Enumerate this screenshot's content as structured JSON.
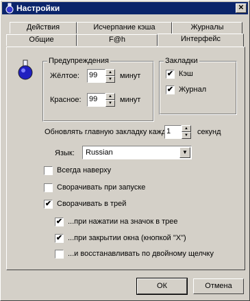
{
  "window": {
    "title": "Настройки",
    "close_glyph": "✕"
  },
  "tabs_row1": [
    "Действия",
    "Исчерпание кэша",
    "Журналы"
  ],
  "tabs_row2": [
    "Общие",
    "F@h",
    "Интерфейс"
  ],
  "active_tab": "Интерфейс",
  "warnings": {
    "title": "Предупреждения",
    "yellow_label": "Жёлтое:",
    "yellow_value": "99",
    "yellow_unit": "минут",
    "red_label": "Красное:",
    "red_value": "99",
    "red_unit": "минут"
  },
  "bookmarks": {
    "title": "Закладки",
    "cache_label": "Кэш",
    "cache_checked": true,
    "journal_label": "Журнал",
    "journal_checked": true
  },
  "refresh": {
    "label": "Обновлять главную закладку кажд",
    "value": "1",
    "unit": "секунд"
  },
  "language": {
    "label": "Язык:",
    "value": "Russian"
  },
  "options": [
    {
      "label": "Всегда наверху",
      "checked": false
    },
    {
      "label": "Сворачивать при запуске",
      "checked": false
    },
    {
      "label": "Сворачивать в трей",
      "checked": true
    }
  ],
  "tray_options": [
    {
      "label": "...при нажатии на значок в трее",
      "checked": true
    },
    {
      "label": "...при закрытии окна (кнопкой \"X\")",
      "checked": true
    },
    {
      "label": "...и восстанавливать по двойному щелчку",
      "checked": false
    }
  ],
  "buttons": {
    "ok": "ОК",
    "cancel": "Отмена"
  },
  "icons": {
    "app": "flask-icon",
    "check": "✔"
  }
}
